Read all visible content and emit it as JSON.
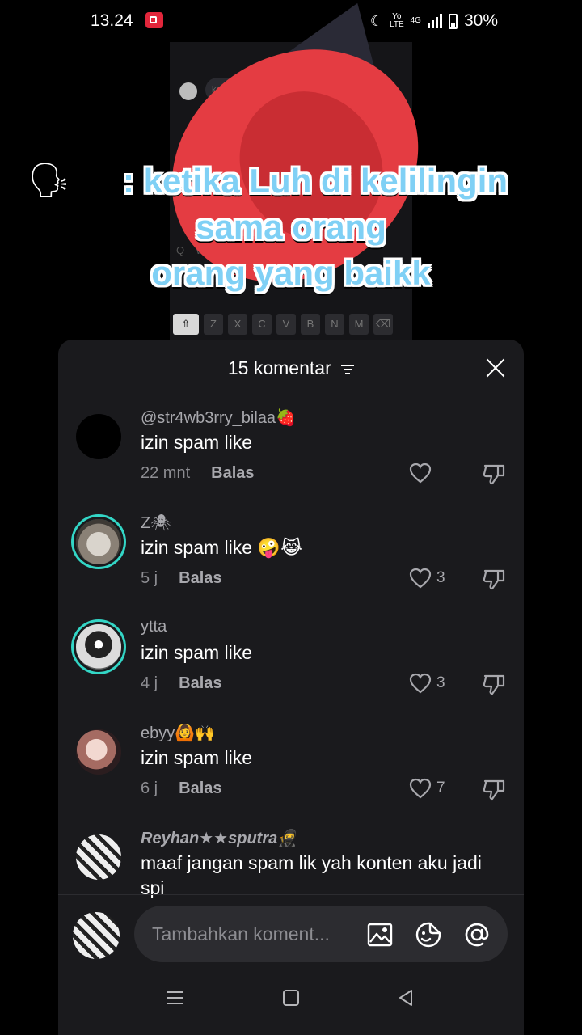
{
  "status_bar": {
    "time": "13.24",
    "network_label_top": "Yo",
    "network_label_bottom": "LTE",
    "network_type": "4G",
    "battery": "30%"
  },
  "video": {
    "caption_lines": [
      "ketika Luh di kelilingin",
      "sama orang",
      "orang yang baikk"
    ],
    "caption_prefix_emoji": "🗣",
    "caption_prefix": ":"
  },
  "comments_sheet": {
    "title": "15 komentar",
    "comments": [
      {
        "user": "@str4wb3rry_bilaa🍓",
        "text": "izin spam like",
        "time": "22 mnt",
        "reply": "Balas",
        "likes": ""
      },
      {
        "user": "Z🕷",
        "text": "izin spam like 🤪😹",
        "time": "5 j",
        "reply": "Balas",
        "likes": "3"
      },
      {
        "user": "ytta",
        "text": "izin spam like",
        "time": "4 j",
        "reply": "Balas",
        "likes": "3"
      },
      {
        "user": "ebyy🙆🙌",
        "text": "izin spam like",
        "time": "6 j",
        "reply": "Balas",
        "likes": "7"
      },
      {
        "user": "Reyhan★★sputra🥷",
        "text": "maaf jangan spam lik yah konten aku jadi spi",
        "time": "",
        "reply": "",
        "likes": ""
      }
    ],
    "input": {
      "placeholder": "Tambahkan koment..."
    }
  },
  "colors": {
    "sheet_bg": "#1a1a1d",
    "ring": "#33d6c6",
    "caption": "#7fd0f5"
  }
}
